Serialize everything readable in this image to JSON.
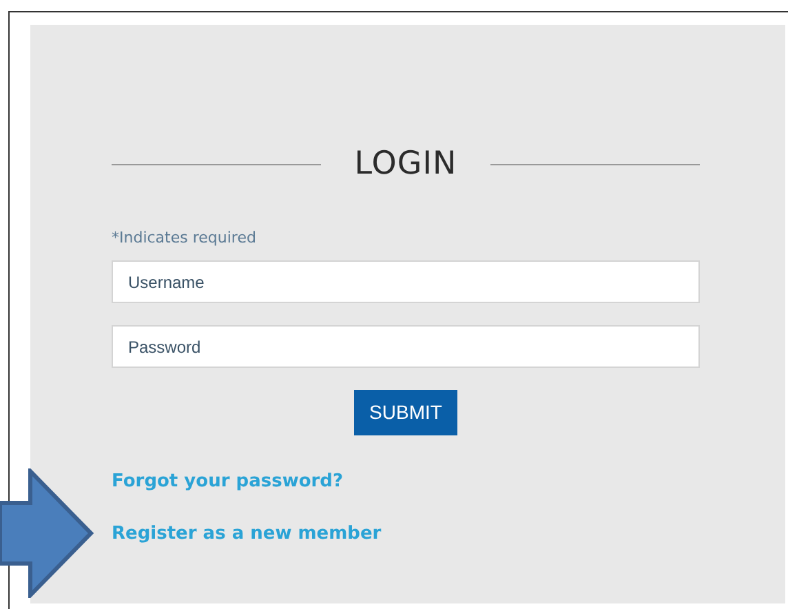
{
  "title": "LOGIN",
  "required_note": "*Indicates required",
  "fields": [
    {
      "placeholder": "Username"
    },
    {
      "placeholder": "Password"
    }
  ],
  "submit": "SUBMIT",
  "links": [
    "Forgot your password?",
    "Register as a new member"
  ]
}
